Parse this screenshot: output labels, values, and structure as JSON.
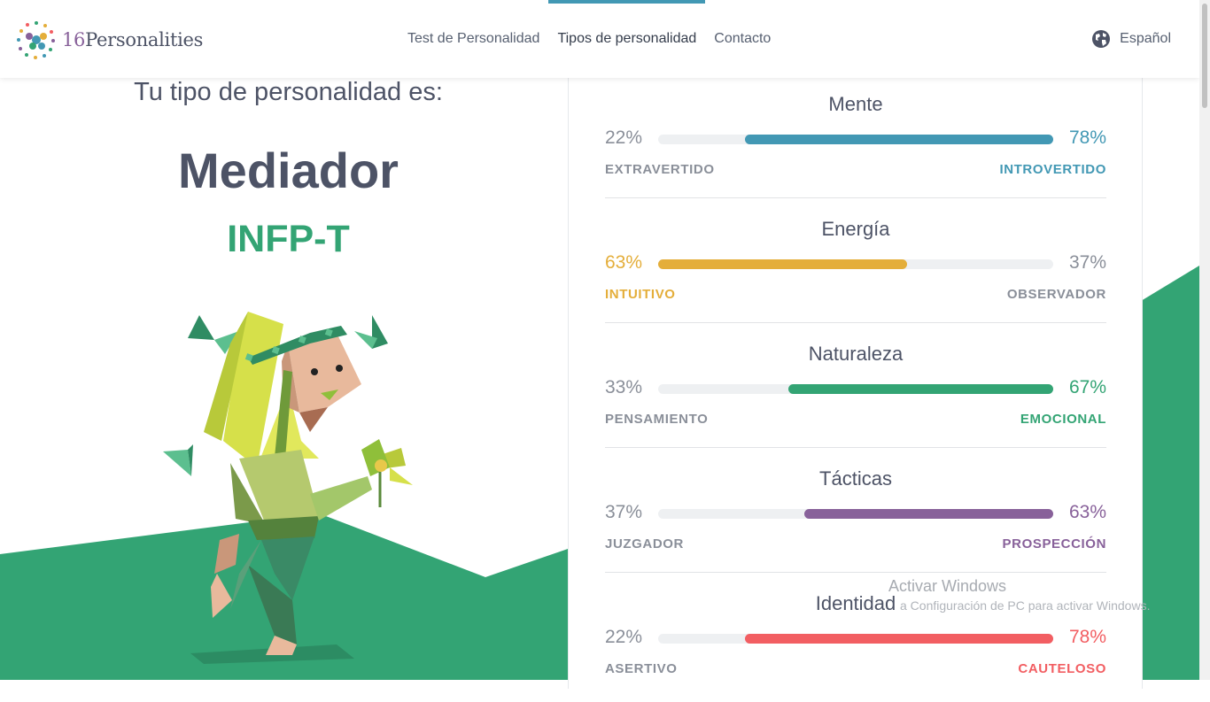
{
  "header": {
    "logo": {
      "number": "16",
      "word": "Personalities"
    },
    "nav": [
      {
        "label": "Test de Personalidad",
        "active": false
      },
      {
        "label": "Tipos de personalidad",
        "active": true
      },
      {
        "label": "Contacto",
        "active": false
      }
    ],
    "language": {
      "icon": "globe-icon",
      "label": "Español"
    }
  },
  "result": {
    "subtitle": "Tu tipo de personalidad es:",
    "type_name": "Mediador",
    "type_code": "INFP-T"
  },
  "traits": [
    {
      "title": "Mente",
      "left_pct": "22%",
      "right_pct": "78%",
      "left_label": "EXTRAVERTIDO",
      "right_label": "INTROVERTIDO",
      "fill_side": "right",
      "fill_value": 78,
      "color": "#4298b4"
    },
    {
      "title": "Energía",
      "left_pct": "63%",
      "right_pct": "37%",
      "left_label": "INTUITIVO",
      "right_label": "OBSERVADOR",
      "fill_side": "left",
      "fill_value": 63,
      "color": "#e4ae3a"
    },
    {
      "title": "Naturaleza",
      "left_pct": "33%",
      "right_pct": "67%",
      "left_label": "PENSAMIENTO",
      "right_label": "EMOCIONAL",
      "fill_side": "right",
      "fill_value": 67,
      "color": "#33a474"
    },
    {
      "title": "Tácticas",
      "left_pct": "37%",
      "right_pct": "63%",
      "left_label": "JUZGADOR",
      "right_label": "PROSPECCIÓN",
      "fill_side": "right",
      "fill_value": 63,
      "color": "#88619a"
    },
    {
      "title": "Identidad",
      "left_pct": "22%",
      "right_pct": "78%",
      "left_label": "ASERTIVO",
      "right_label": "CAUTELOSO",
      "fill_side": "right",
      "fill_value": 78,
      "color": "#f25e62"
    }
  ],
  "watermark": {
    "line1": "Activar Windows",
    "line2": "a Configuración de PC para activar Windows."
  }
}
